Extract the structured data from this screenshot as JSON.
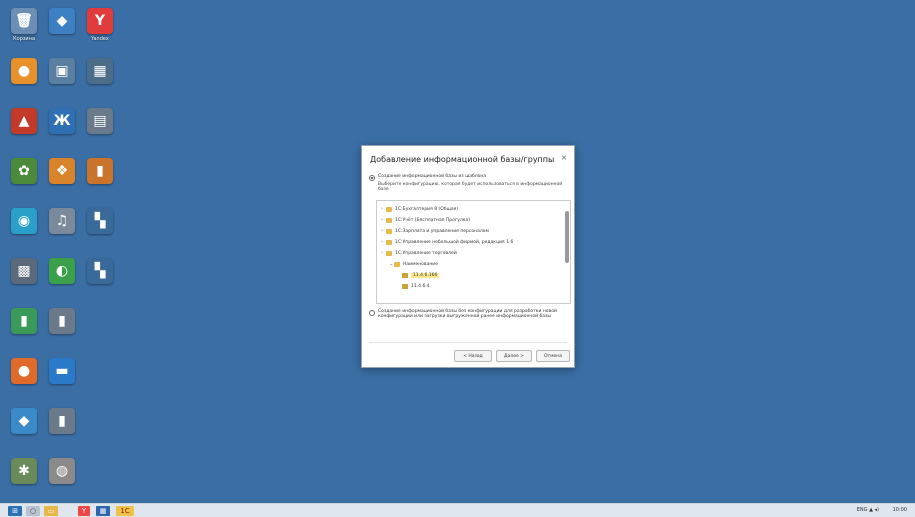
{
  "window_title": "Добавление информационной базы/группы",
  "desktop_icons": [
    [
      {
        "label": "Корзина",
        "icon": "recycle-bin-icon",
        "color": "#6d8fb3",
        "glyph": "🗑"
      },
      {
        "label": "",
        "icon": "app-icon",
        "color": "#3c7fc2",
        "glyph": "◆"
      },
      {
        "label": "Yandex",
        "icon": "yandex-browser-icon",
        "color": "#e23b3b",
        "glyph": "Y"
      }
    ],
    [
      {
        "label": "",
        "icon": "app-icon",
        "color": "#e8902a",
        "glyph": "●"
      },
      {
        "label": "",
        "icon": "app-icon",
        "color": "#5a7fa0",
        "glyph": "▣"
      },
      {
        "label": "",
        "icon": "app-icon",
        "color": "#4c6d8a",
        "glyph": "▦"
      }
    ],
    [
      {
        "label": "",
        "icon": "app-icon",
        "color": "#c23a2a",
        "glyph": "▲"
      },
      {
        "label": "",
        "icon": "app-icon",
        "color": "#2f6fb4",
        "glyph": "Ж"
      },
      {
        "label": "",
        "icon": "app-icon",
        "color": "#6a7a8a",
        "glyph": "▤"
      }
    ],
    [
      {
        "label": "",
        "icon": "app-icon",
        "color": "#4a8a3a",
        "glyph": "✿"
      },
      {
        "label": "",
        "icon": "app-icon",
        "color": "#d9842a",
        "glyph": "❖"
      },
      {
        "label": "",
        "icon": "app-icon",
        "color": "#c9742a",
        "glyph": "▮"
      }
    ],
    [
      {
        "label": "",
        "icon": "app-icon",
        "color": "#2aa0c9",
        "glyph": "◉"
      },
      {
        "label": "",
        "icon": "app-icon",
        "color": "#7a8a9a",
        "glyph": "♫"
      },
      {
        "label": "",
        "icon": "app-icon",
        "color": "#3a6a9a",
        "glyph": "▚"
      }
    ],
    [
      {
        "label": "",
        "icon": "app-icon",
        "color": "#5a6a7a",
        "glyph": "▩"
      },
      {
        "label": "",
        "icon": "app-icon",
        "color": "#3aa04a",
        "glyph": "◐"
      },
      {
        "label": "",
        "icon": "app-icon",
        "color": "#3a6a9a",
        "glyph": "▚"
      }
    ],
    [
      {
        "label": "",
        "icon": "app-icon",
        "color": "#3a9a5a",
        "glyph": "▮"
      },
      {
        "label": "",
        "icon": "app-icon",
        "color": "#6a7a8a",
        "glyph": "▮"
      }
    ],
    [
      {
        "label": "",
        "icon": "app-icon",
        "color": "#e06a2a",
        "glyph": "●"
      },
      {
        "label": "",
        "icon": "app-icon",
        "color": "#2a7ac9",
        "glyph": "▬"
      }
    ],
    [
      {
        "label": "",
        "icon": "app-icon",
        "color": "#3a8ac9",
        "glyph": "◆"
      },
      {
        "label": "",
        "icon": "app-icon",
        "color": "#6a7a8a",
        "glyph": "▮"
      }
    ],
    [
      {
        "label": "",
        "icon": "app-icon",
        "color": "#6a8a5a",
        "glyph": "✱"
      },
      {
        "label": "",
        "icon": "app-icon",
        "color": "#8a8a8a",
        "glyph": "◍"
      }
    ]
  ],
  "dialog": {
    "title": "Добавление информационной базы/группы",
    "close": "×",
    "radio1_label": "Создание информационной базы из шаблона",
    "radio1_desc": "Выберите конфигурацию, которая будет использоваться в информационной базе",
    "tree": [
      {
        "text": "1С:Бухгалтерия 8 (Общая)",
        "level": 0,
        "kind": "folder",
        "twisty": "›"
      },
      {
        "text": "1С:Учёт (Бесплатная Прогулка)",
        "level": 0,
        "kind": "folder",
        "twisty": "›"
      },
      {
        "text": "1С:Зарплата и управление персоналом",
        "level": 0,
        "kind": "folder",
        "twisty": "›"
      },
      {
        "text": "1С:Управление небольшой фирмой, редакция 1.6",
        "level": 0,
        "kind": "folder",
        "twisty": "›"
      },
      {
        "text": "1С:Управление торговлей",
        "level": 0,
        "kind": "folder",
        "twisty": "›"
      },
      {
        "text": "Наименование",
        "level": 1,
        "kind": "folder",
        "twisty": "⌄"
      },
      {
        "text": "11.4.6.166",
        "level": 2,
        "kind": "base",
        "twisty": "",
        "selected": true
      },
      {
        "text": "11.4.6.4",
        "level": 2,
        "kind": "base",
        "twisty": ""
      }
    ],
    "radio2_label": "Создание информационной базы без конфигурации для разработки новой конфигурации или загрузки выгруженной ранее информационной базы",
    "buttons": {
      "back": "< Назад",
      "next": "Далее >",
      "cancel": "Отмена"
    }
  },
  "taskbar": {
    "start": "⊞",
    "search": "○",
    "explorer": "▭",
    "yandex": "Y",
    "app": "▦",
    "onec": "1C",
    "tray": "ENG ▲ ◂)",
    "clock": "10:00"
  }
}
